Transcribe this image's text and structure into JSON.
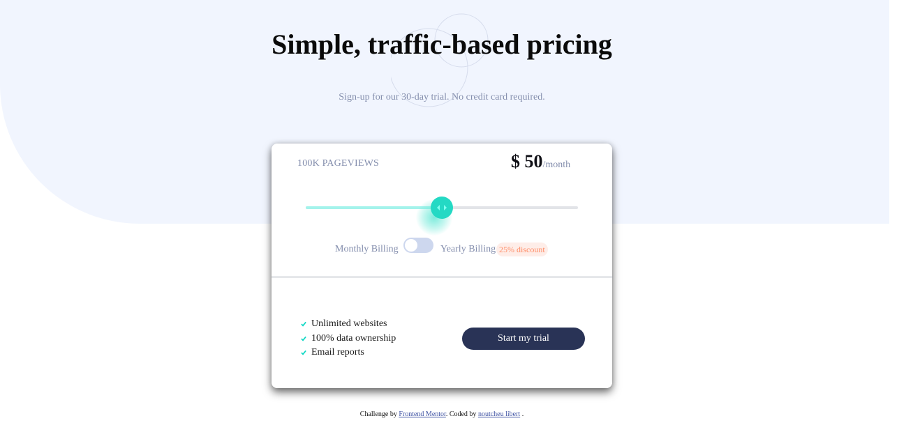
{
  "hero": {
    "title": "Simple, traffic-based pricing",
    "subtitle": "Sign-up for our 30-day trial. No credit card required."
  },
  "card": {
    "pageviews": "100K PAGEVIEWS",
    "price": {
      "amount": "$ 50",
      "period": "/month"
    },
    "slider": {
      "value_fraction": 0.5
    },
    "billing": {
      "monthly_label": "Monthly Billing",
      "yearly_label": "Yearly Billing",
      "discount": "25% discount",
      "yearly_selected": false
    },
    "features": [
      "Unlimited websites",
      "100% data ownership",
      "Email reports"
    ],
    "cta": "Start my trial"
  },
  "footer": {
    "prefix": "Challenge by",
    "link1": "Frontend Mentor",
    "middle": ". Coded by",
    "link2": "noutcheu libert",
    "suffix": "."
  },
  "colors": {
    "hero_bg": "#f1f5fe",
    "accent": "#24d9c4",
    "slider_fill": "#a4f3eb",
    "button_bg": "#293356",
    "discount_bg": "#feede8",
    "discount_text": "#ff8c66",
    "muted_text": "#848ead"
  },
  "icons": {
    "slider": "arrows-left-right-icon",
    "feature_bullet": "check-icon",
    "background_decoration": "circles-pattern-icon"
  }
}
